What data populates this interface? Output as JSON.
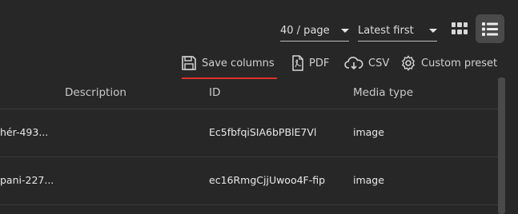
{
  "toolbar": {
    "page_size": "40 / page",
    "sort": "Latest first",
    "grid_view_icon": "grid-icon",
    "list_view_icon": "list-icon",
    "actions": [
      {
        "label": "Save columns",
        "icon": "save-icon"
      },
      {
        "label": "PDF",
        "icon": "pdf-file-icon"
      },
      {
        "label": "CSV",
        "icon": "cloud-download-icon"
      },
      {
        "label": "Custom preset",
        "icon": "gear-icon"
      }
    ]
  },
  "table": {
    "columns": [
      "Description",
      "ID",
      "Media type"
    ],
    "rows": [
      {
        "name": "hér-493...",
        "id": "Ec5fbfqiSIA6bPBlE7Vl",
        "media_type": "image"
      },
      {
        "name": "pani-227...",
        "id": "ec16RmgCjjUwoo4F-fip",
        "media_type": "image"
      }
    ]
  },
  "colors": {
    "background": "#272727",
    "accent_underline": "#e0302a",
    "active_view_bg": "#4a4a4a"
  }
}
